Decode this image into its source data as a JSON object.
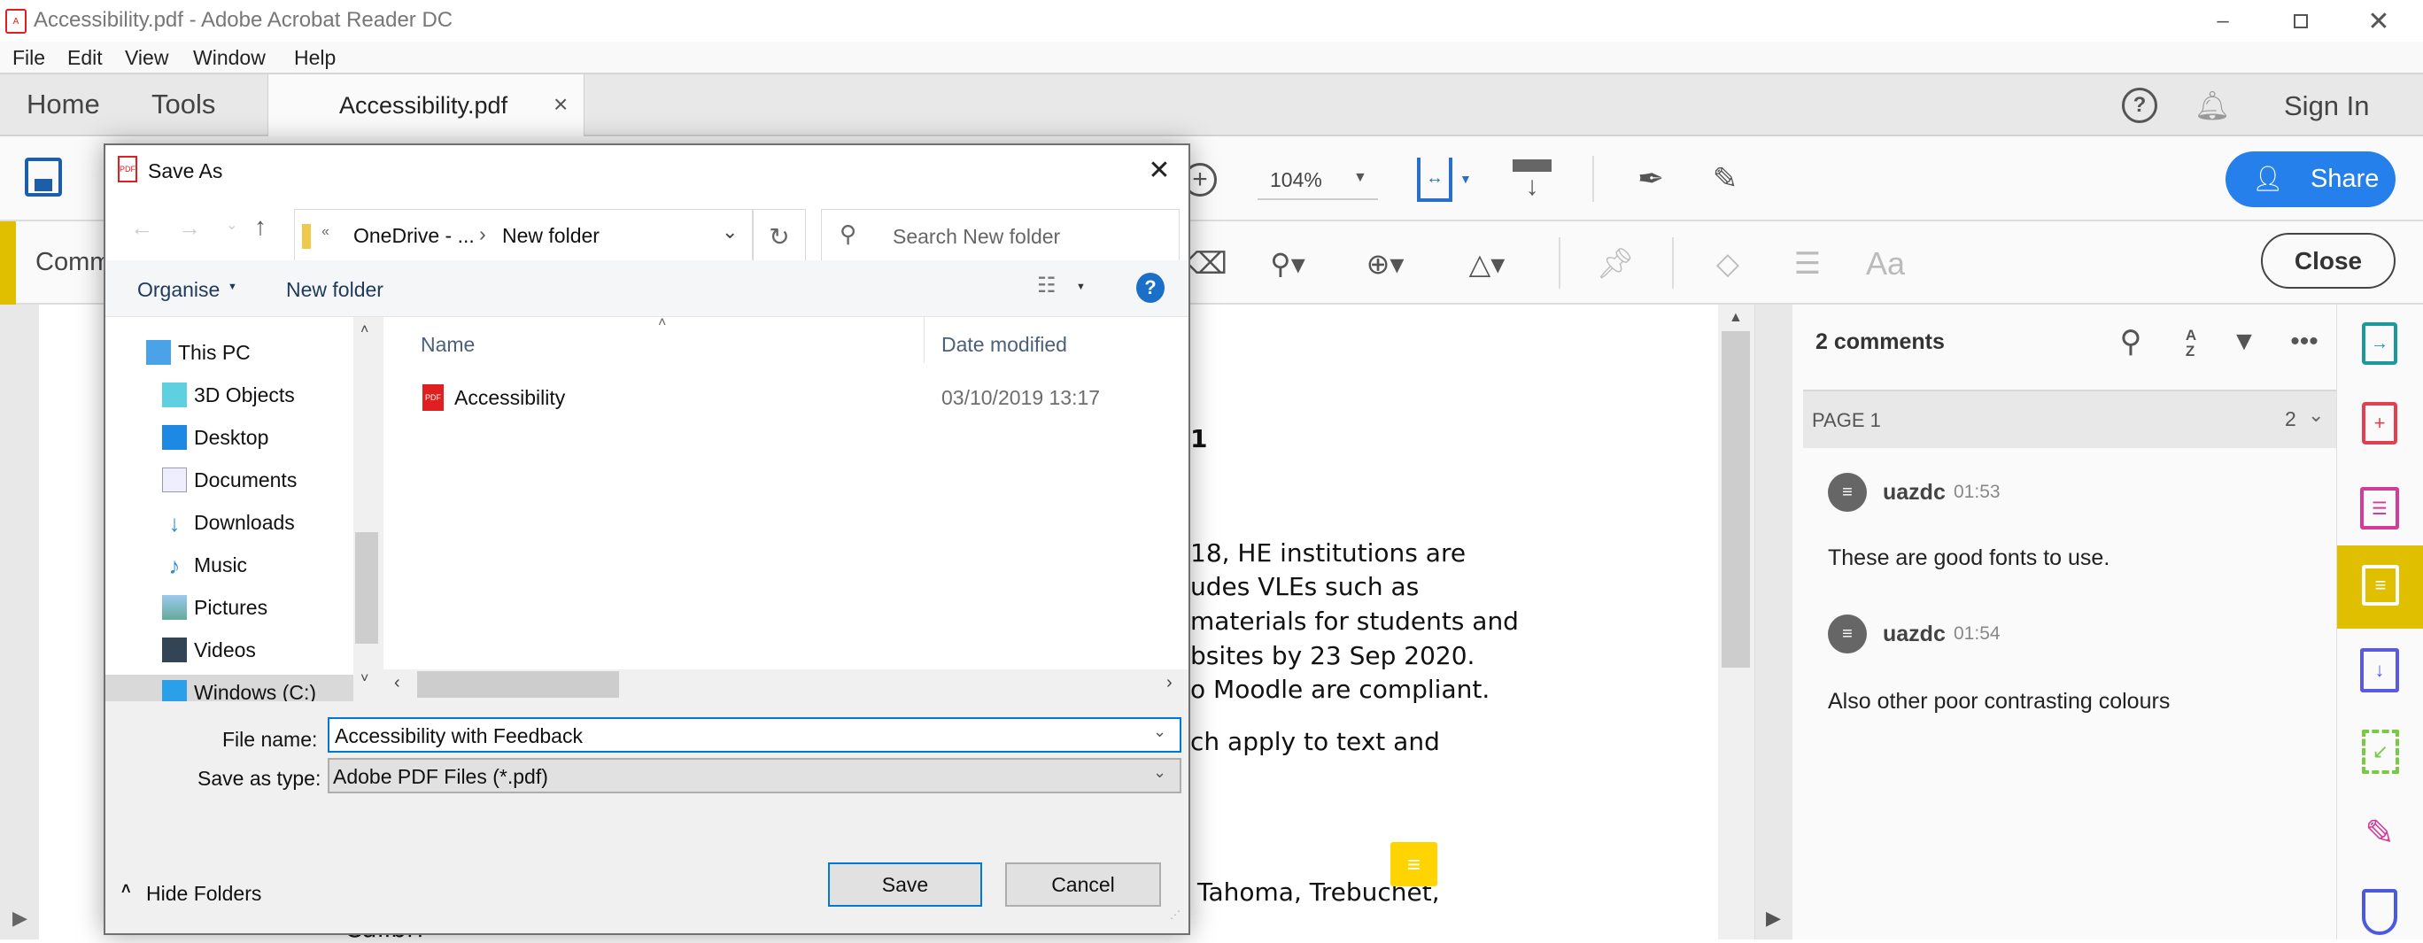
{
  "window": {
    "title": "Accessibility.pdf - Adobe Acrobat Reader DC",
    "controls": [
      "minimize",
      "restore",
      "close"
    ]
  },
  "menu": [
    "File",
    "Edit",
    "View",
    "Window",
    "Help"
  ],
  "tabs": {
    "home": "Home",
    "tools": "Tools",
    "document": "Accessibility.pdf",
    "close_glyph": "×",
    "sign_in": "Sign In"
  },
  "toolbar": {
    "zoom": "104%",
    "share": "Share"
  },
  "comment_toolbar": {
    "label": "Comm",
    "close": "Close"
  },
  "document": {
    "heading": "1",
    "lines": [
      "18, HE institutions are",
      "udes VLEs such as",
      "materials for students and",
      "bsites by 23 Sep 2020.",
      "o Moodle are compliant.",
      "ch apply to text and",
      "Tahoma, Trebuchet,",
      "Calibri"
    ]
  },
  "comments_pane": {
    "count": "2 comments",
    "page_label": "PAGE 1",
    "page_count": "2",
    "comments": [
      {
        "author": "uazdc",
        "time": "01:53",
        "text": "These are good fonts to use."
      },
      {
        "author": "uazdc",
        "time": "01:54",
        "text": "Also other poor contrasting colours"
      }
    ]
  },
  "right_rail": [
    "export-pdf",
    "create-pdf",
    "organize-pages",
    "comment",
    "compress-pdf",
    "fill-sign",
    "request-signature",
    "protect"
  ],
  "dialog": {
    "title": "Save As",
    "breadcrumb": {
      "overflow": "«",
      "parent": "OneDrive - ...",
      "current": "New folder"
    },
    "search_placeholder": "Search New folder",
    "organise": "Organise",
    "new_folder": "New folder",
    "nav": [
      "This PC",
      "3D Objects",
      "Desktop",
      "Documents",
      "Downloads",
      "Music",
      "Pictures",
      "Videos",
      "Windows (C:)"
    ],
    "columns": {
      "name": "Name",
      "date": "Date modified"
    },
    "files": [
      {
        "name": "Accessibility",
        "date": "03/10/2019 13:17",
        "type": "pdf"
      }
    ],
    "file_name_label": "File name:",
    "file_name": "Accessibility with Feedback",
    "save_type_label": "Save as type:",
    "save_type": "Adobe PDF Files (*.pdf)",
    "hide_folders": "Hide Folders",
    "save": "Save",
    "cancel": "Cancel"
  },
  "colors": {
    "accent_blue": "#2680eb",
    "comment_yellow": "#e0bf00",
    "win_blue": "#0078d7"
  }
}
